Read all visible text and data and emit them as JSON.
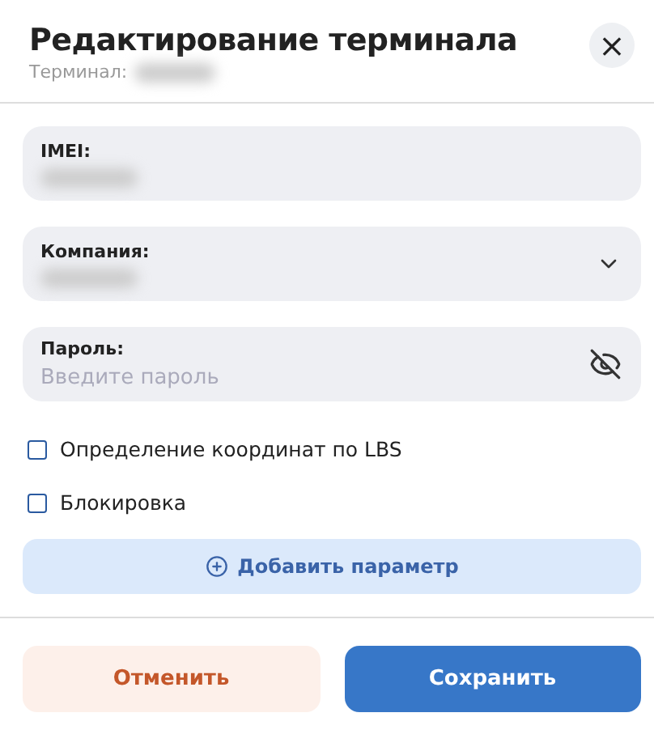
{
  "dialog": {
    "title": "Редактирование терминала",
    "subtitle": {
      "label": "Терминал:",
      "redacted": true
    },
    "close_icon": "×"
  },
  "fields": [
    {
      "kind": "text",
      "label": "IMEI:",
      "redacted": true
    },
    {
      "kind": "select",
      "label": "Компания:",
      "redacted": true
    },
    {
      "kind": "password",
      "label": "Пароль:",
      "placeholder": "Введите пароль",
      "redacted": false
    }
  ],
  "checkboxes": [
    {
      "label": "Определение координат по LBS",
      "checked": false
    },
    {
      "label": "Блокировка",
      "checked": false
    }
  ],
  "add_button": "Добавить параметр",
  "buttons": [
    {
      "kind": "secondary",
      "label": "Отменить"
    },
    {
      "kind": "primary",
      "label": "Сохранить"
    }
  ]
}
